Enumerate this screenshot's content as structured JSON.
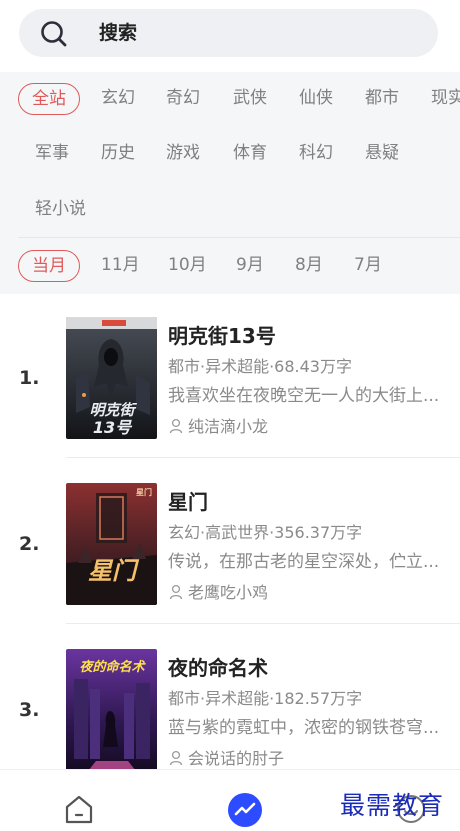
{
  "search": {
    "label": "搜索"
  },
  "categories": {
    "row1": [
      "全站",
      "玄幻",
      "奇幻",
      "武侠",
      "仙侠",
      "都市",
      "现实"
    ],
    "row2": [
      "军事",
      "历史",
      "游戏",
      "体育",
      "科幻",
      "悬疑"
    ],
    "row3": [
      "轻小说"
    ],
    "selected": "全站"
  },
  "months": {
    "items": [
      "当月",
      "11月",
      "10月",
      "9月",
      "8月",
      "7月"
    ],
    "selected": "当月"
  },
  "books": [
    {
      "rank": "1.",
      "title": "明克街13号",
      "meta": "都市·异术超能·68.43万字",
      "desc": "我喜欢坐在夜晚空无一人的大街上...",
      "author": "纯洁滴小龙",
      "cover_text": "明克街13号",
      "cover_colors": [
        "#3b3f46",
        "#14161a"
      ]
    },
    {
      "rank": "2.",
      "title": "星门",
      "meta": "玄幻·高武世界·356.37万字",
      "desc": "传说，在那古老的星空深处，伫立...",
      "author": "老鹰吃小鸡",
      "cover_text": "星门",
      "cover_colors": [
        "#7a2a2a",
        "#2a1518"
      ]
    },
    {
      "rank": "3.",
      "title": "夜的命名术",
      "meta": "都市·异术超能·182.57万字",
      "desc": "蓝与紫的霓虹中，浓密的钢铁苍穹...",
      "author": "会说话的肘子",
      "cover_text": "夜的命名术",
      "cover_colors": [
        "#5b2a8a",
        "#1b1030"
      ]
    }
  ],
  "watermark": "最需教育",
  "theme": {
    "accent": "#e05a5a",
    "tab_active": "#2d4bff"
  }
}
